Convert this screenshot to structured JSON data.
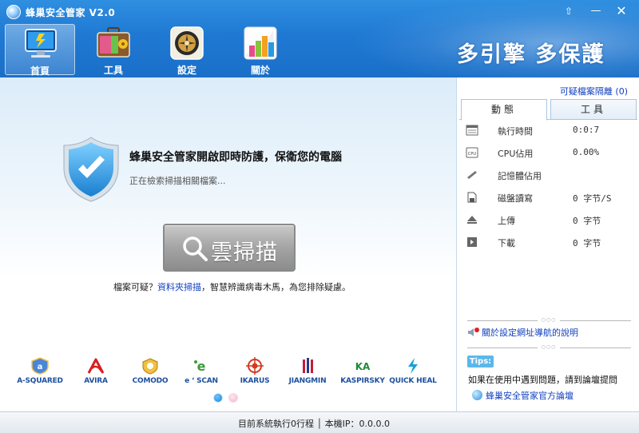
{
  "window": {
    "title": "蜂巢安全管家 V2.0",
    "pin_glyph": "⇧",
    "min_glyph": "—",
    "close_glyph": "✕"
  },
  "nav": {
    "items": [
      {
        "label": "首頁",
        "icon": "monitor-icon"
      },
      {
        "label": "工具",
        "icon": "toolbox-icon"
      },
      {
        "label": "設定",
        "icon": "settings-icon"
      },
      {
        "label": "關於",
        "icon": "about-icon"
      }
    ],
    "active": "首頁"
  },
  "slogan": "多引擎  多保護",
  "main": {
    "protect_title": "蜂巢安全管家開啟即時防護，保衛您的電腦",
    "scan_status": "正在檢索掃描相關檔案...",
    "cloud_scan_label": "雲掃描",
    "hint_prefix": "檔案可疑？",
    "hint_link": "資料夾掃描",
    "hint_suffix": "，智慧辨識病毒木馬，為您排除疑慮。"
  },
  "engines": [
    {
      "name": "A-SQUARED",
      "color": "#3a6fc4"
    },
    {
      "name": "AVIRA",
      "color": "#d62020"
    },
    {
      "name": "COMODO",
      "color": "#e0a020"
    },
    {
      "name": "e ‘ SCAN",
      "color": "#3a9a3a"
    },
    {
      "name": "IKARUS",
      "color": "#d23a20"
    },
    {
      "name": "JIANGMIN",
      "color": "#c41e3a"
    },
    {
      "name": "KASPIRSKY",
      "color": "#1d8a3a"
    },
    {
      "name": "QUICK HEAL",
      "color": "#1aa0d8"
    }
  ],
  "carousel": {
    "pages": 2,
    "active_page": 1
  },
  "right": {
    "quarantine_link": "可疑檔案隔離 (0)",
    "tabs": [
      {
        "label": "動態"
      },
      {
        "label": "工具"
      }
    ],
    "active_tab": "動態",
    "stats": [
      {
        "label": "執行時間",
        "value": "0:0:7",
        "icon": "clock-icon"
      },
      {
        "label": "CPU佔用",
        "value": "0.00%",
        "icon": "cpu-icon"
      },
      {
        "label": "記憶體佔用",
        "value": "",
        "icon": "memory-icon"
      },
      {
        "label": "磁盤讀寫",
        "value": "0 字节/S",
        "icon": "disk-icon"
      },
      {
        "label": "上傳",
        "value": "0 字节",
        "icon": "upload-icon"
      },
      {
        "label": "下載",
        "value": "0 字节",
        "icon": "download-icon"
      }
    ],
    "nav_help_link": "關於設定網址導航的說明",
    "tips_badge": "Tips:",
    "tips_text": "如果在使用中遇到問題，請到論壇提問",
    "forum_link": "蜂巢安全管家官方論壇"
  },
  "status": {
    "text": "目前系統執行0行程 │ 本機IP：0.0.0.0"
  }
}
